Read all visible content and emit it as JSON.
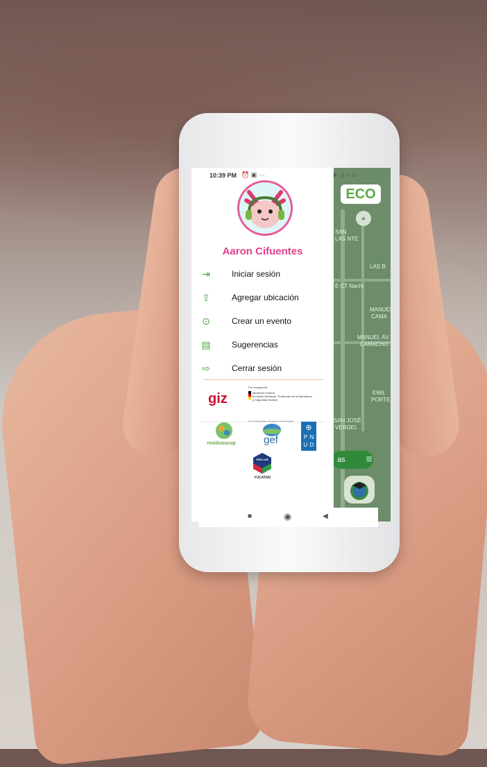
{
  "status_bar": {
    "time": "10:39 PM",
    "left_icons": "⏰ ▣ ···",
    "right_icons": "➤ .ıl ◔ ▭"
  },
  "drawer": {
    "username": "Aaron Cifuentes",
    "menu": [
      {
        "label": "Iniciar sesión",
        "icon": "login-icon"
      },
      {
        "label": "Agregar ubicación",
        "icon": "upload-location-icon"
      },
      {
        "label": "Crear un evento",
        "icon": "play-circle-icon"
      },
      {
        "label": "Sugerencias",
        "icon": "suggestions-icon"
      },
      {
        "label": "Cerrar sesión",
        "icon": "logout-icon"
      }
    ],
    "logos": {
      "giz": "giz",
      "ministry_top": "Por encargo de:",
      "ministry_lines": [
        "Ministerio Federal",
        "de Medio Ambiente, Protección de la Naturaleza",
        "y Seguridad Nuclear"
      ],
      "ministry_bottom": "de la República Federal de Alemania",
      "residuos": "residuoscop",
      "gef": "gef",
      "pnud": [
        "P",
        "N",
        "U",
        "D"
      ],
      "fab": "FAB LAB",
      "fab_sub": "YUCATAN"
    }
  },
  "map": {
    "app_badge": "ECO",
    "labels": [
      "SAN",
      "LAS NTE",
      "LAS B",
      "E CT Nachi",
      "MANUEL",
      "CAMA",
      "MANUEL ÁV",
      "CAMACHO",
      "EMIL",
      "PORTES",
      "SAN JOSÉ",
      "VERGEL"
    ],
    "pill_text": "as"
  },
  "nav_bar": {
    "square": "■",
    "circle": "◉",
    "back": "◀"
  }
}
